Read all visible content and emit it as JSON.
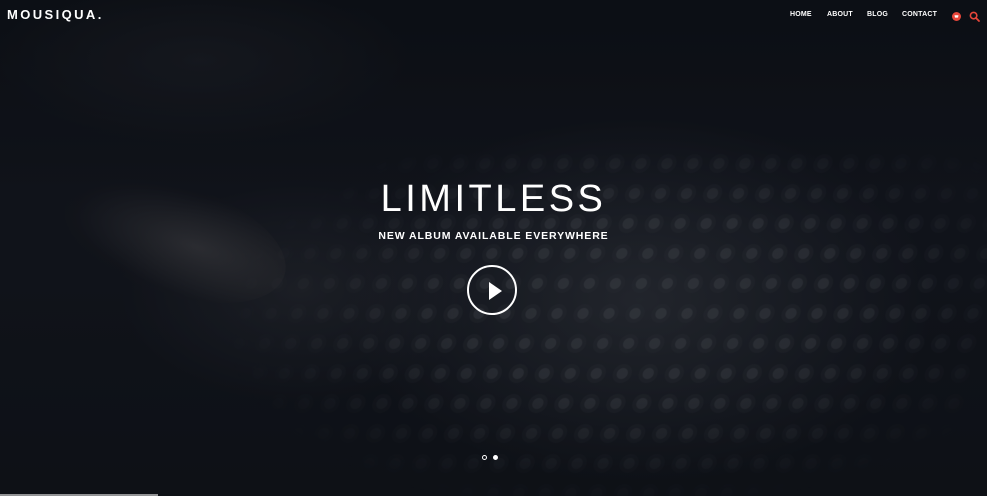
{
  "brand": {
    "logo": "MOUSIQUA."
  },
  "nav": {
    "items": [
      "HOME",
      "ABOUT",
      "BLOG",
      "CONTACT"
    ],
    "icons": [
      "cart-icon",
      "search-icon"
    ]
  },
  "hero": {
    "title": "LIMITLESS",
    "subtitle": "NEW ALBUM AVAILABLE EVERYWHERE",
    "play_icon": "play-icon"
  },
  "slider": {
    "slides": 2,
    "active_slide": 2,
    "progress_fraction": 0.16
  },
  "colors": {
    "accent": "#e8463a",
    "text": "#ffffff",
    "background": "#0c0e13"
  }
}
